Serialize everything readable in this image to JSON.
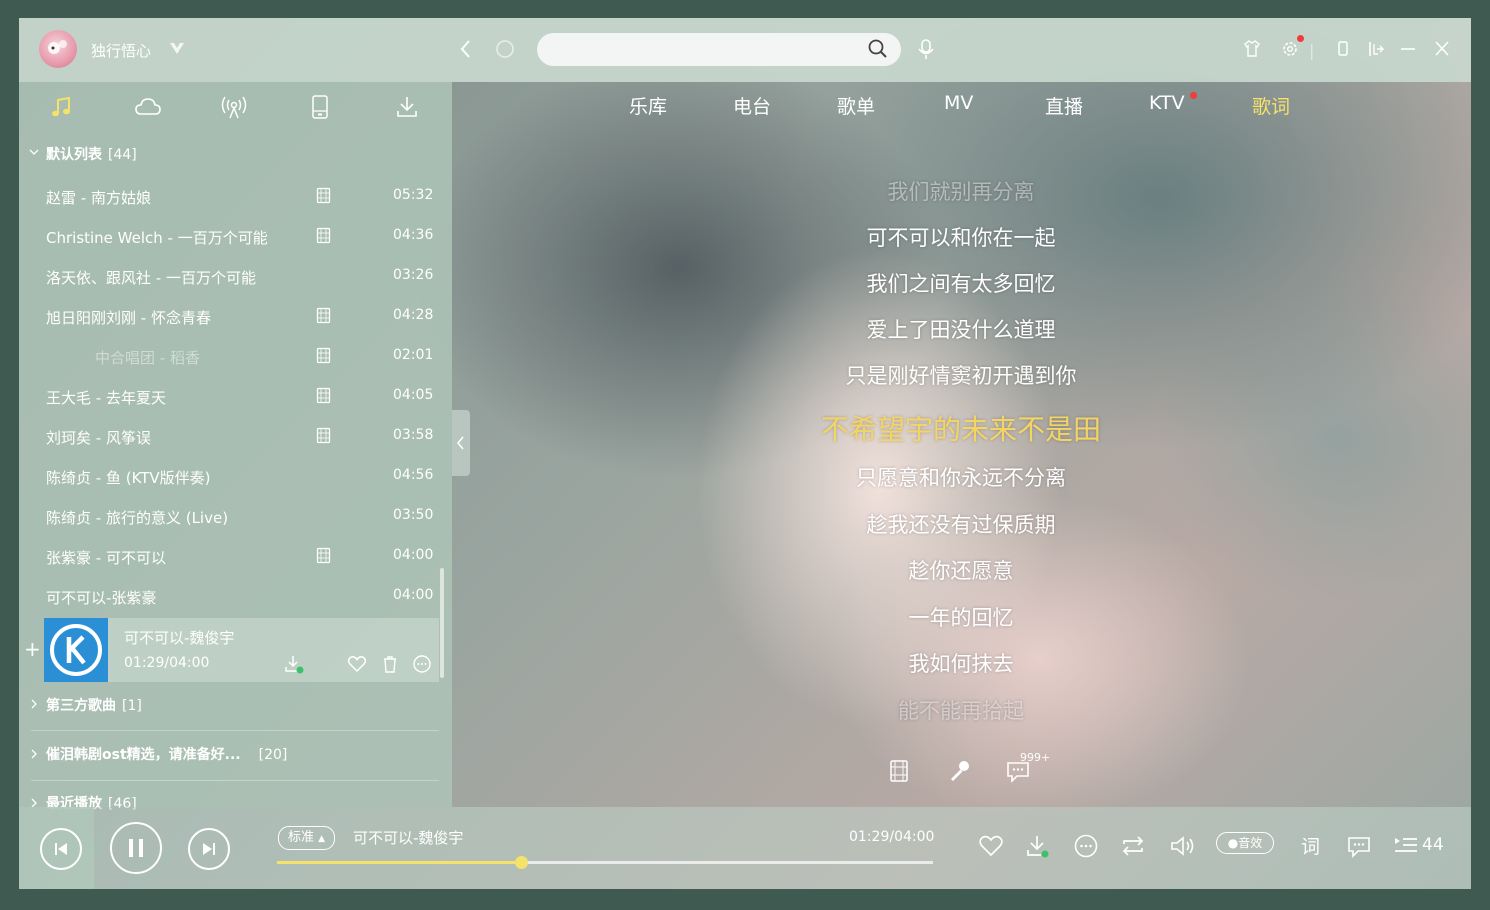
{
  "titlebar": {
    "username": "独行悟心",
    "search_placeholder": "",
    "badge_dot_color": "#f23b3b"
  },
  "sidebar_tabs": [
    "music-note-icon",
    "cloud-icon",
    "radio-icon",
    "phone-icon",
    "download-icon"
  ],
  "groups": {
    "default": {
      "label": "默认列表",
      "count": "[44]"
    },
    "third": {
      "label": "第三方歌曲",
      "count": "[1]"
    },
    "ost": {
      "label": "催泪韩剧ost精选，请准备好...",
      "count": "[20]"
    },
    "recent": {
      "label": "最近播放",
      "count": "[46]"
    }
  },
  "songs": [
    {
      "name": "赵雷 - 南方姑娘",
      "duration": "05:32",
      "mv": true
    },
    {
      "name": "Christine Welch - 一百万个可能",
      "duration": "04:36",
      "mv": true
    },
    {
      "name": "洛天依、跟风社 - 一百万个可能",
      "duration": "03:26",
      "mv": false
    },
    {
      "name": "旭日阳刚刘刚 - 怀念青春",
      "duration": "04:28",
      "mv": true
    },
    {
      "name": "中合唱团 - 稻香",
      "duration": "02:01",
      "mv": true
    },
    {
      "name": "王大毛 - 去年夏天",
      "duration": "04:05",
      "mv": true
    },
    {
      "name": "刘珂矣 - 风筝误",
      "duration": "03:58",
      "mv": true
    },
    {
      "name": "陈绮贞 - 鱼 (KTV版伴奏)",
      "duration": "04:56",
      "mv": false
    },
    {
      "name": "陈绮贞 - 旅行的意义 (Live)",
      "duration": "03:50",
      "mv": false
    },
    {
      "name": "张紫豪 - 可不可以",
      "duration": "04:00",
      "mv": true
    },
    {
      "name": "可不可以-张紫豪",
      "duration": "04:00",
      "mv": false
    }
  ],
  "now_playing": {
    "title": "可不可以-魏俊宇",
    "time": "01:29/04:00"
  },
  "nav": [
    "乐库",
    "电台",
    "歌单",
    "MV",
    "直播",
    "KTV",
    "歌词"
  ],
  "lyrics": {
    "prev": [
      "我们就别再分离",
      "可不可以和你在一起",
      "我们之间有太多回忆",
      "爱上了田没什么道理",
      "只是刚好情窦初开遇到你"
    ],
    "current": "不希望宇的未来不是田",
    "next": [
      "只愿意和你永远不分离",
      "趁我还没有过保质期",
      "趁你还愿意",
      "一年的回忆",
      "我如何抹去",
      "能不能再拾起"
    ]
  },
  "comments_badge": "999+",
  "player": {
    "quality": "标准",
    "track": "可不可以-魏俊宇",
    "time": "01:29/04:00",
    "progress": 0.372,
    "effect": "音效",
    "lyrics_btn": "词",
    "playlist_count": "44"
  },
  "colors": {
    "accent": "#f4e26b",
    "lyric_current": "#f4d463",
    "now_cover": "#2b8fd6"
  }
}
